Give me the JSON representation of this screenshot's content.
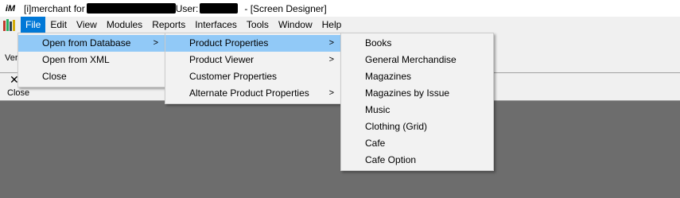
{
  "title": {
    "logo": "iM",
    "app_name": "[i]merchant for",
    "user_label": "User:",
    "mode": "- [Screen Designer]"
  },
  "menubar": {
    "icon": "books-app-icon",
    "items": [
      "File",
      "Edit",
      "View",
      "Modules",
      "Reports",
      "Interfaces",
      "Tools",
      "Window",
      "Help"
    ]
  },
  "toolbar": {
    "ver_label": "Ver",
    "close_label": "Close",
    "close_icon": "close-x-icon"
  },
  "file_menu": {
    "items": [
      {
        "label": "Open from Database",
        "has_submenu": true,
        "highlighted": true
      },
      {
        "label": "Open from XML",
        "has_submenu": false
      },
      {
        "label": "Close",
        "has_submenu": false
      }
    ]
  },
  "db_menu": {
    "items": [
      {
        "label": "Product Properties",
        "has_submenu": true,
        "highlighted": true
      },
      {
        "label": "Product Viewer",
        "has_submenu": true
      },
      {
        "label": "Customer Properties",
        "has_submenu": false
      },
      {
        "label": "Alternate Product Properties",
        "has_submenu": true
      }
    ]
  },
  "pp_menu": {
    "items": [
      "Books",
      "General Merchandise",
      "Magazines",
      "Magazines by Issue",
      "Music",
      "Clothing (Grid)",
      "Cafe",
      "Cafe Option"
    ]
  },
  "submenu_arrow": ">",
  "colors": {
    "menu_active": "#0078d7",
    "menu_highlight": "#91c9f7",
    "workspace": "#6d6d6d"
  }
}
